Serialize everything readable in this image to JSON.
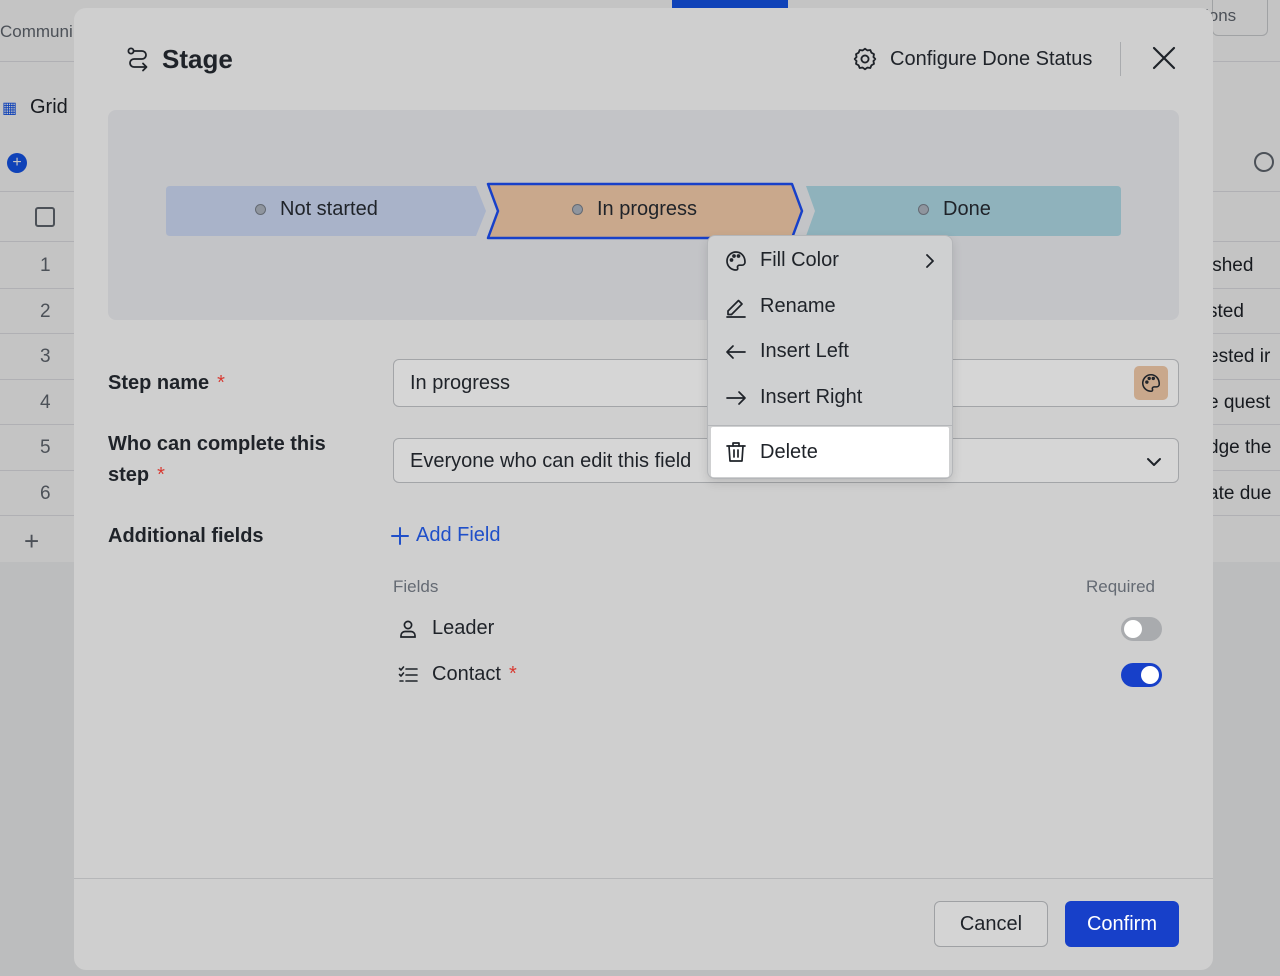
{
  "background": {
    "community_label": "Communi",
    "actions_label": "ions",
    "view_label": "Grid",
    "row_numbers": [
      "1",
      "2",
      "3",
      "4",
      "5",
      "6"
    ],
    "row_texts": [
      "ished",
      "sted",
      "ested ir",
      "e quest",
      "dge the",
      "ate due"
    ]
  },
  "modal": {
    "title": "Stage",
    "configure_label": "Configure Done Status",
    "stages": [
      "Not started",
      "In progress",
      "Done"
    ],
    "selected_stage": "In progress",
    "step_name_label": "Step name",
    "step_name_value": "In progress",
    "who_label_line1": "Who can complete this",
    "who_label_line2": "step",
    "who_value": "Everyone who can edit this field",
    "additional_label": "Additional fields",
    "add_field_label": "Add Field",
    "fields_header": "Fields",
    "required_header": "Required",
    "fields": [
      {
        "name": "Leader",
        "icon": "person-icon",
        "required_mark": false,
        "toggle_on": false
      },
      {
        "name": "Contact",
        "icon": "checklist-icon",
        "required_mark": true,
        "toggle_on": true
      }
    ],
    "required_asterisk": "*",
    "cancel_label": "Cancel",
    "confirm_label": "Confirm"
  },
  "context_menu": {
    "items": [
      {
        "label": "Fill Color",
        "icon": "palette-icon"
      },
      {
        "label": "Rename",
        "icon": "pencil-icon"
      },
      {
        "label": "Insert Left",
        "icon": "arrow-left-icon"
      },
      {
        "label": "Insert Right",
        "icon": "arrow-right-icon"
      },
      {
        "label": "Delete",
        "icon": "trash-icon"
      }
    ],
    "highlighted": "Delete"
  },
  "colors": {
    "accent": "#1740c9",
    "required": "#d83931",
    "stage_not_started": "#a9b3c9",
    "stage_in_progress": "#c9a88c",
    "stage_done": "#8fb2bc"
  }
}
